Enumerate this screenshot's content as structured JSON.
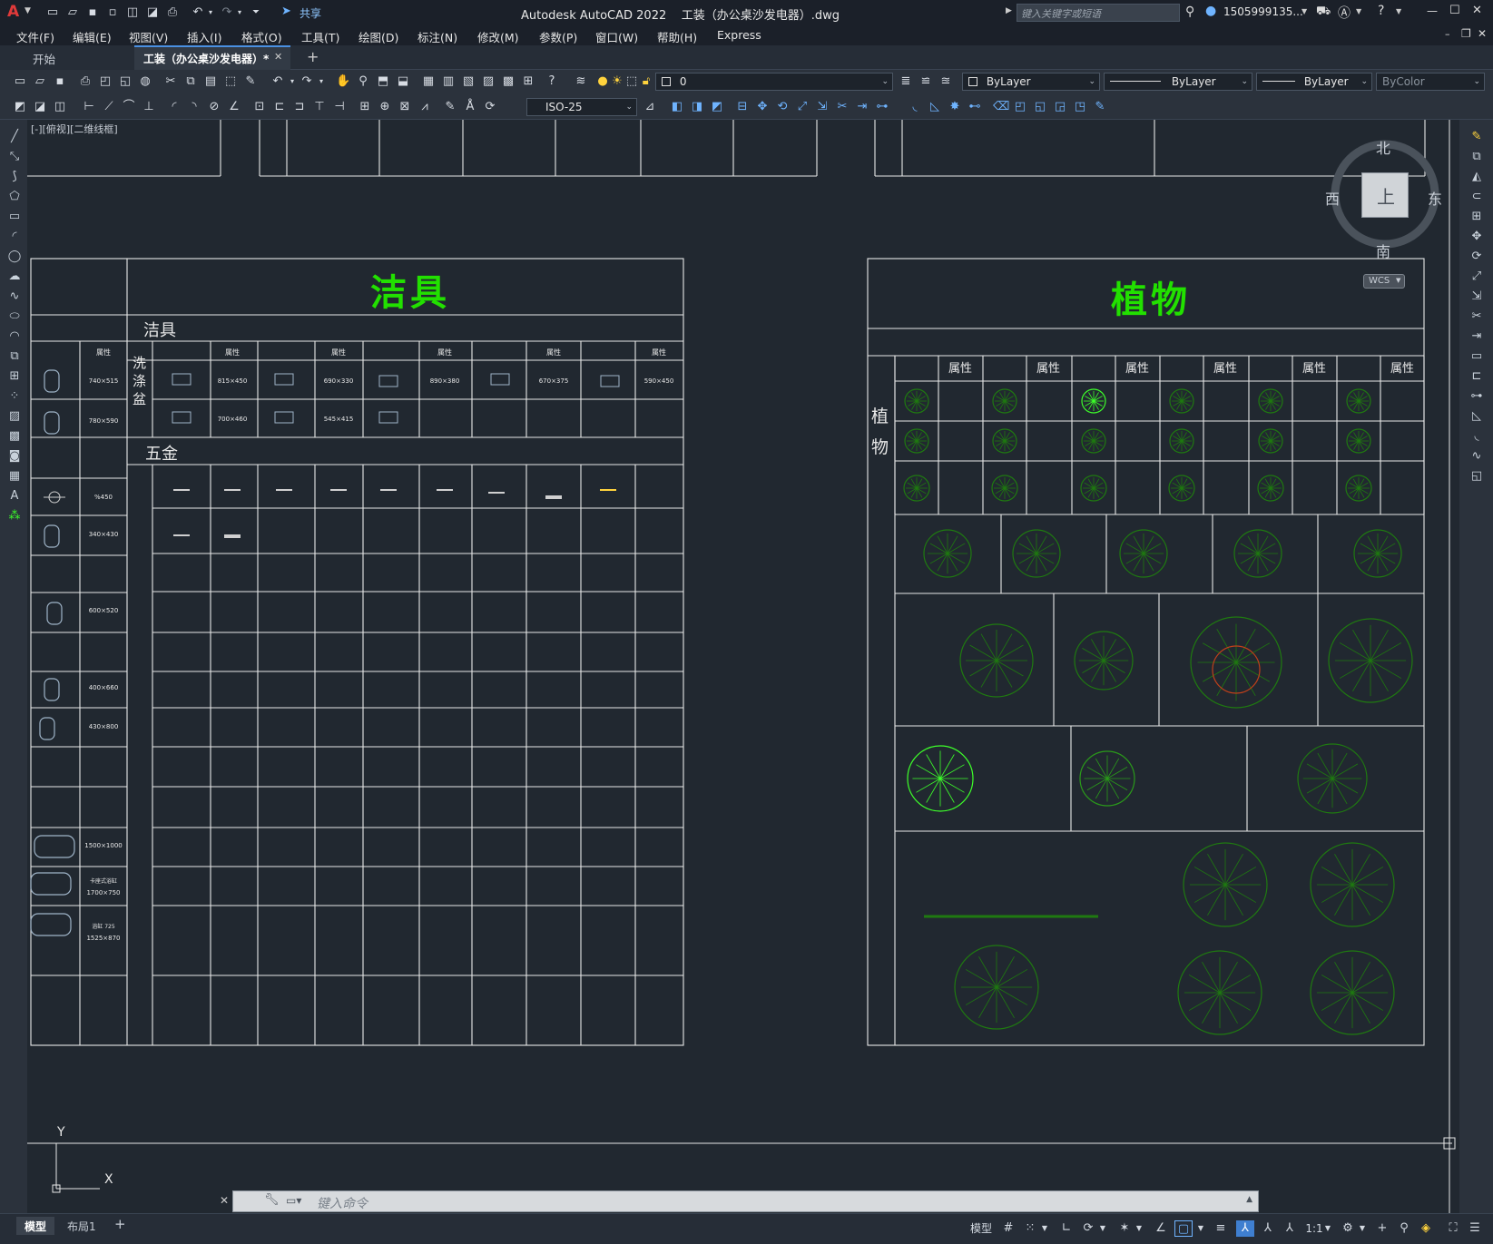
{
  "titlebar": {
    "app_logo": "A",
    "share_label": "共享",
    "title": "Autodesk AutoCAD 2022    工装（办公桌沙发电器）.dwg",
    "search_placeholder": "键入关键字或短语",
    "user": "1505999135...",
    "window_buttons": [
      "—",
      "☐",
      "✕"
    ]
  },
  "menubar": {
    "items": [
      "文件(F)",
      "编辑(E)",
      "视图(V)",
      "插入(I)",
      "格式(O)",
      "工具(T)",
      "绘图(D)",
      "标注(N)",
      "修改(M)",
      "参数(P)",
      "窗口(W)",
      "帮助(H)",
      "Express"
    ]
  },
  "tabs": {
    "start": "开始",
    "active": "工装（办公桌沙发电器）*",
    "add": "+"
  },
  "toolbar": {
    "layer_value": "0",
    "color_value": "ByLayer",
    "linetype_value": "ByLayer",
    "lineweight_value": "ByLayer",
    "plotstyle_value": "ByColor",
    "dimstyle_value": "ISO-25"
  },
  "viewport": {
    "label": "[-][俯视][二维线框]",
    "viewcube": {
      "north": "北",
      "south": "南",
      "east": "东",
      "west": "西",
      "face": "上",
      "wcs": "WCS"
    },
    "ucs": {
      "x": "X",
      "y": "Y"
    }
  },
  "drawing": {
    "left_panel": {
      "title": "洁具",
      "section1": "洁具",
      "wash_basin_label": [
        "洗",
        "涤",
        "盆"
      ],
      "section2": "五金",
      "attr_header": "属性",
      "left_sizes": [
        "740×515",
        "780×590",
        "%450",
        "340×430",
        "600×520",
        "400×660",
        "430×800",
        "1500×1000",
        "1700×750",
        "1525×870"
      ],
      "basin_sizes_row1": [
        "815×450",
        "690×330",
        "890×380",
        "670×375",
        "590×450"
      ],
      "basin_sizes_row2": [
        "700×460",
        "545×415"
      ]
    },
    "right_panel": {
      "title": "植物",
      "side_label": [
        "植",
        "物"
      ],
      "attr_header": "属性"
    }
  },
  "command": {
    "placeholder": "键入命令"
  },
  "statusbar": {
    "tabs": [
      "模型",
      "布局1",
      "+"
    ],
    "model_label": "模型",
    "scale": "1:1"
  },
  "colors": {
    "background": "#212830",
    "title_green": "#22e000",
    "line_white": "#e8e8e8",
    "plant_green": "#1f7a10",
    "plant_bright": "#3dff2a"
  }
}
